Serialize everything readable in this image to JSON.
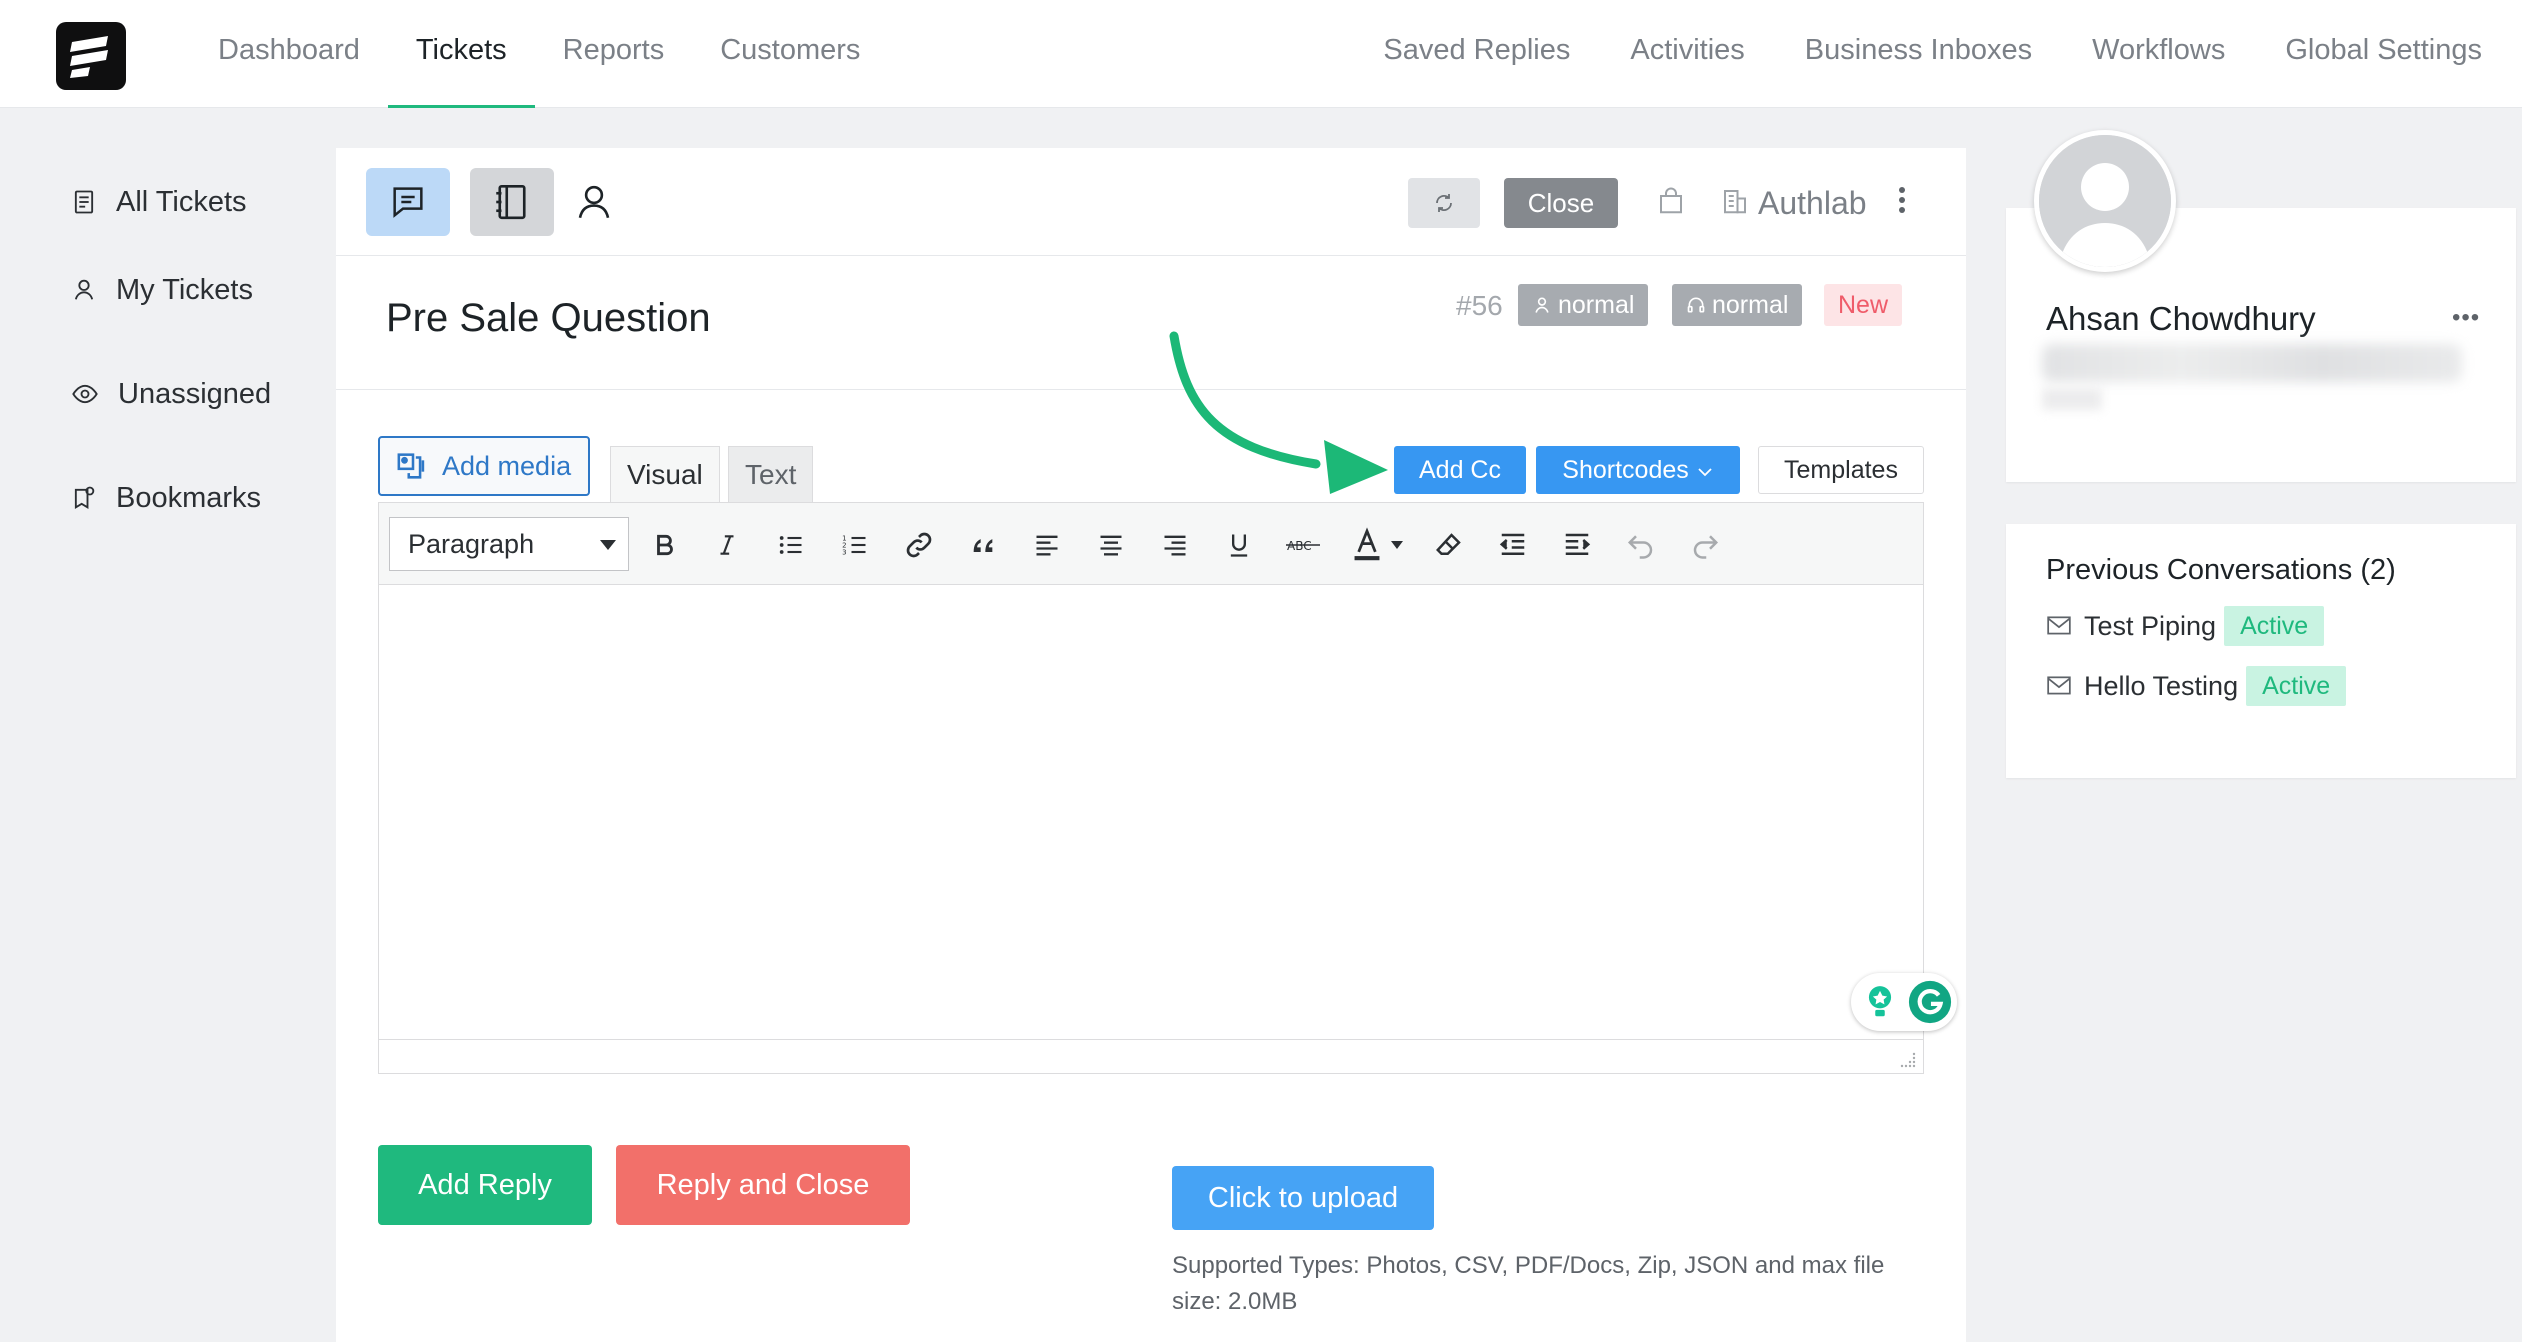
{
  "topnav": {
    "left": [
      "Dashboard",
      "Tickets",
      "Reports",
      "Customers"
    ],
    "right": [
      "Saved Replies",
      "Activities",
      "Business Inboxes",
      "Workflows",
      "Global Settings"
    ]
  },
  "sidebar": {
    "items": [
      {
        "label": "All Tickets",
        "icon": "list-icon"
      },
      {
        "label": "My Tickets",
        "icon": "user-icon"
      },
      {
        "label": "Unassigned",
        "icon": "eye-icon"
      },
      {
        "label": "Bookmarks",
        "icon": "bookmark-icon"
      }
    ]
  },
  "toolbar": {
    "close_label": "Close",
    "mailbox": "Authlab"
  },
  "ticket": {
    "title": "Pre Sale Question",
    "number": "#56",
    "priority_customer": "normal",
    "priority_agent": "normal",
    "status": "New"
  },
  "editor": {
    "add_media": "Add media",
    "tab_visual": "Visual",
    "tab_text": "Text",
    "add_cc": "Add Cc",
    "shortcodes": "Shortcodes",
    "templates": "Templates",
    "format_select": "Paragraph"
  },
  "actions": {
    "add_reply": "Add Reply",
    "reply_close": "Reply and Close",
    "upload": "Click to upload",
    "upload_note": "Supported Types: Photos, CSV, PDF/Docs, Zip, JSON and max file size: 2.0MB"
  },
  "customer": {
    "name": "Ahsan Chowdhury"
  },
  "previous": {
    "title": "Previous Conversations (2)",
    "items": [
      {
        "subject": "Test Piping",
        "status": "Active"
      },
      {
        "subject": "Hello Testing",
        "status": "Active"
      }
    ]
  },
  "colors": {
    "accent_green": "#1fb97e",
    "primary_blue": "#3797f2",
    "danger": "#f2706a",
    "arrow": "#1cb877"
  }
}
